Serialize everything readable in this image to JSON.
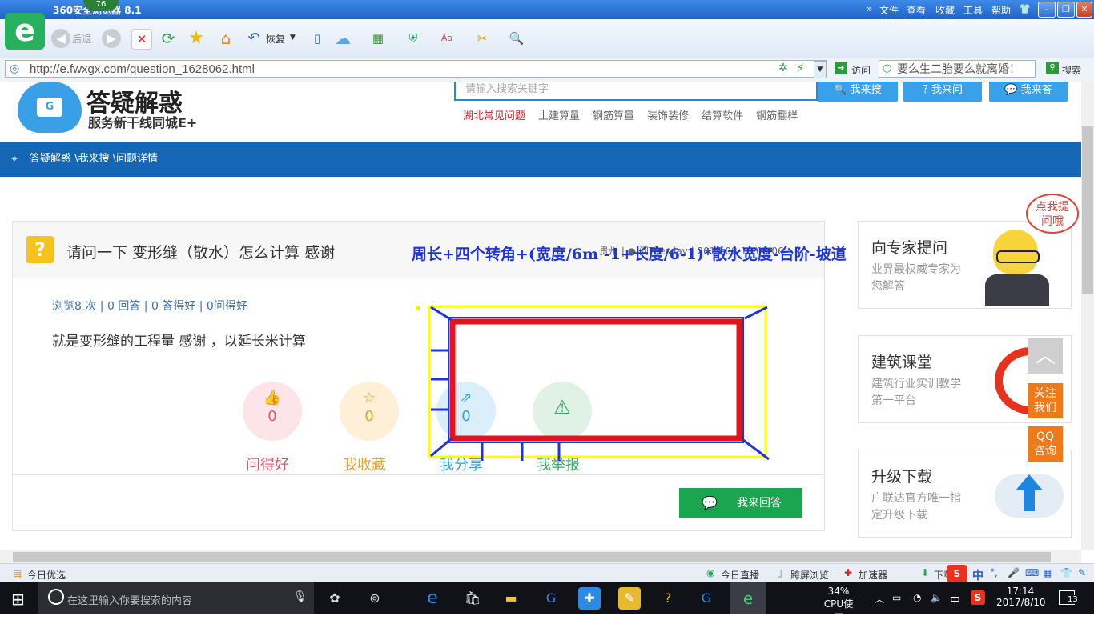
{
  "browser": {
    "title": "360安全浏览器 8.1",
    "badge": "76",
    "logo_letter": "e",
    "menu": [
      "文件",
      "查看",
      "收藏",
      "工具",
      "帮助"
    ],
    "toolbar": {
      "back_label": "后退",
      "restore_label": "恢复"
    },
    "address": "http://e.fwxgx.com/question_1628062.html",
    "visit_label": "访问",
    "search_placeholder": "要么生二胎要么就离婚！",
    "search_label": "搜索"
  },
  "site": {
    "logo_title": "答疑解惑",
    "logo_subtitle": "服务新干线同城E+",
    "search_placeholder": "请输入搜索关键字",
    "buttons": [
      "我来搜",
      "我来问",
      "我来答"
    ],
    "hot_links": [
      "湖北常见问题",
      "土建算量",
      "钢筋算量",
      "装饰装修",
      "结算软件",
      "钢筋翻样"
    ],
    "breadcrumb": "答疑解惑 \\我来搜 \\问题详情"
  },
  "question": {
    "title": "请问一下 变形缝（散水）怎么计算 感谢",
    "meta": "贵州 | ● 问Tuesday | 2017-08-10 08:06",
    "stats": "浏览8 次 | 0 回答 | 0 答得好 | 0问得好",
    "body": "就是变形缝的工程量   感谢   ，以延长米计算",
    "actions": [
      {
        "label": "问得好",
        "count": "0",
        "color": "#e0566a",
        "bg": "#fde4e8"
      },
      {
        "label": "我收藏",
        "count": "0",
        "color": "#e0a33a",
        "bg": "#fdf0d6"
      },
      {
        "label": "我分享",
        "count": "0",
        "color": "#3aa0d8",
        "bg": "#dbeffb"
      },
      {
        "label": "我举报",
        "count": "",
        "color": "#3aab66",
        "bg": "#dff2e5"
      }
    ],
    "answer_button": "我来回答"
  },
  "annotation": {
    "formula": "周长+四个转角+(宽度/6m -1+长度/6-1)*散水宽度-台阶-坡道"
  },
  "sidebar": {
    "cards": [
      {
        "title": "向专家提问",
        "desc": "业界最权威专家为您解答"
      },
      {
        "title": "建筑课堂",
        "desc": "建筑行业实训教学第一平台"
      },
      {
        "title": "升级下载",
        "desc": "广联达官方唯一指定升级下载"
      }
    ],
    "bubble": "点我提问哦",
    "follow": "关注我们",
    "qq": "QQ咨询"
  },
  "statusbar": {
    "left": "今日优选",
    "items": [
      "今日直播",
      "跨屏浏览",
      "加速器",
      "下载"
    ]
  },
  "taskbar": {
    "search_placeholder": "在这里输入你要搜索的内容",
    "cpu": "34%",
    "cpu_label": "CPU使用",
    "ime": "中",
    "time": "17:14",
    "date": "2017/8/10",
    "notifications": "13"
  },
  "colors": {
    "brand_blue": "#1566b5",
    "accent_green": "#1aa64e",
    "annotation_red": "#e8101a",
    "annotation_blue": "#1d34e0"
  }
}
